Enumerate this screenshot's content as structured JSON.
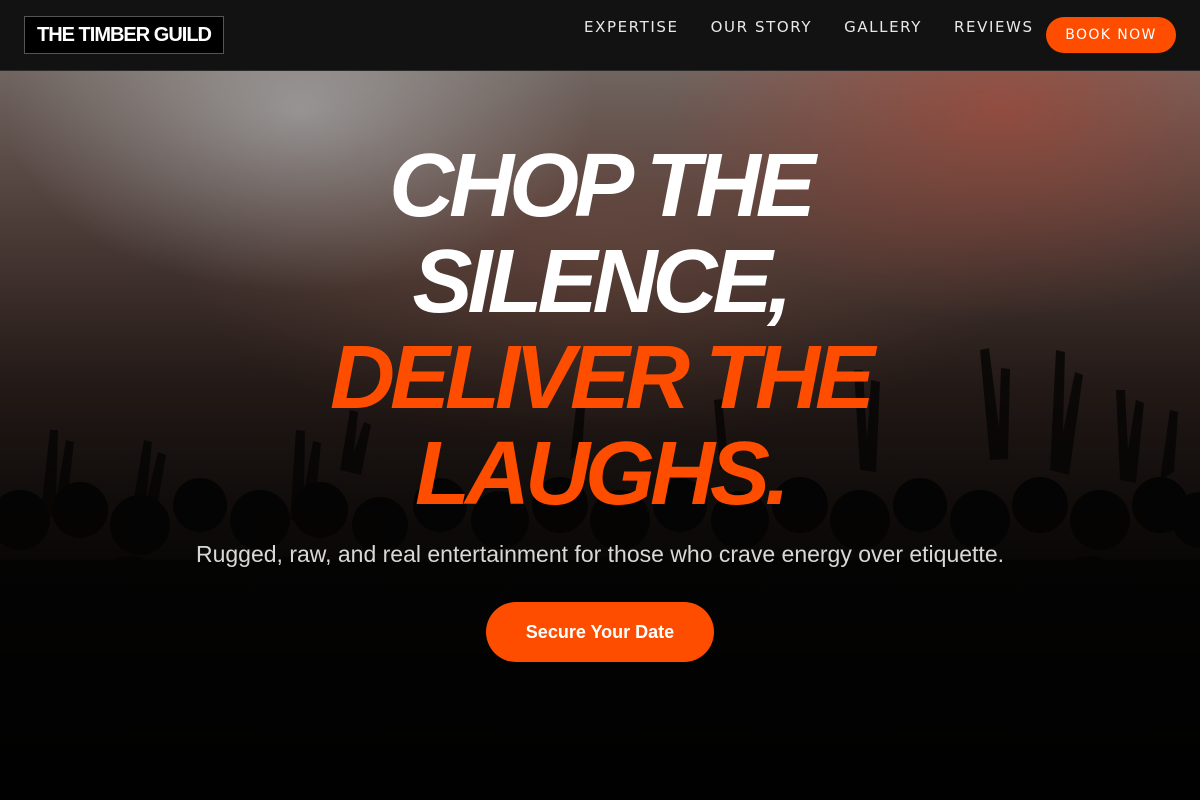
{
  "brand": {
    "name": "THE TIMBER GUILD"
  },
  "nav": {
    "items": [
      {
        "label": "EXPERTISE"
      },
      {
        "label": "OUR STORY"
      },
      {
        "label": "GALLERY"
      },
      {
        "label": "REVIEWS"
      }
    ],
    "book_label": "BOOK NOW"
  },
  "hero": {
    "headline_white_1": "CHOP THE",
    "headline_white_2": "SILENCE,",
    "headline_orange_1": "DELIVER THE",
    "headline_orange_2": "LAUGHS.",
    "subline": "Rugged, raw, and real entertainment for those who crave energy over etiquette.",
    "cta_label": "Secure Your Date",
    "background_image": "concert-crowd-photo"
  },
  "colors": {
    "accent": "#ff4d00",
    "header_bg": "#121212",
    "text_light": "#ffffff"
  }
}
